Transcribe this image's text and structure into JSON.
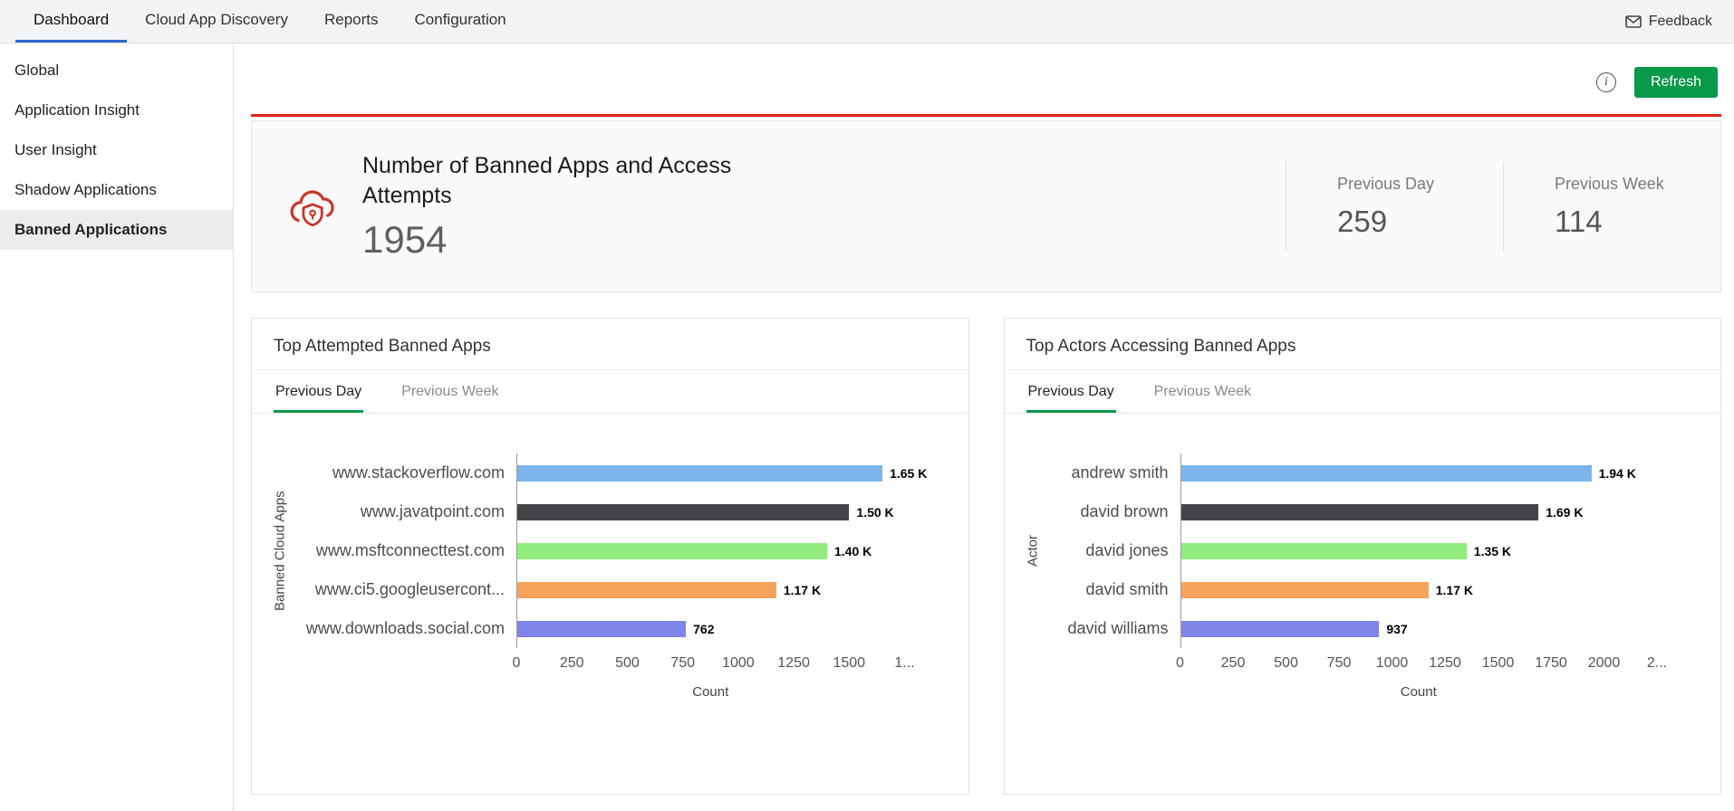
{
  "colors": {
    "accent_blue": "#2e66d0",
    "accent_green": "#089949",
    "accent_red": "#e2231a",
    "icon_red": "#cb3527"
  },
  "topnav": {
    "tabs": [
      {
        "label": "Dashboard",
        "active": true
      },
      {
        "label": "Cloud App Discovery",
        "active": false
      },
      {
        "label": "Reports",
        "active": false
      },
      {
        "label": "Configuration",
        "active": false
      }
    ],
    "feedback_label": "Feedback"
  },
  "sidebar": {
    "items": [
      {
        "label": "Global",
        "active": false
      },
      {
        "label": "Application Insight",
        "active": false
      },
      {
        "label": "User Insight",
        "active": false
      },
      {
        "label": "Shadow Applications",
        "active": false
      },
      {
        "label": "Banned Applications",
        "active": true
      }
    ]
  },
  "toolbar": {
    "refresh_label": "Refresh"
  },
  "summary": {
    "title": "Number of Banned Apps and Access Attempts",
    "total": "1954",
    "stats": [
      {
        "label": "Previous Day",
        "value": "259"
      },
      {
        "label": "Previous Week",
        "value": "114"
      }
    ]
  },
  "cards": [
    {
      "title": "Top Attempted Banned Apps",
      "tabs": [
        {
          "label": "Previous Day",
          "active": true
        },
        {
          "label": "Previous Week",
          "active": false
        }
      ]
    },
    {
      "title": "Top Actors Accessing Banned Apps",
      "tabs": [
        {
          "label": "Previous Day",
          "active": true
        },
        {
          "label": "Previous Week",
          "active": false
        }
      ]
    }
  ],
  "chart_data": [
    {
      "type": "bar",
      "orientation": "horizontal",
      "title": "Top Attempted Banned Apps",
      "categories": [
        "www.stackoverflow.com",
        "www.javatpoint.com",
        "www.msftconnecttest.com",
        "www.ci5.googleusercont...",
        "www.downloads.social.com"
      ],
      "values": [
        1650,
        1500,
        1400,
        1170,
        762
      ],
      "value_labels": [
        "1.65 K",
        "1.50 K",
        "1.40 K",
        "1.17 K",
        "762"
      ],
      "bar_colors": [
        "#7cb5ec",
        "#434348",
        "#90ed7d",
        "#f7a35c",
        "#8085e9"
      ],
      "xlabel": "Count",
      "ylabel": "Banned Cloud Apps",
      "xlim": [
        0,
        1750
      ],
      "x_ticks": [
        {
          "v": 0,
          "label": "0"
        },
        {
          "v": 250,
          "label": "250"
        },
        {
          "v": 500,
          "label": "500"
        },
        {
          "v": 750,
          "label": "750"
        },
        {
          "v": 1000,
          "label": "1000"
        },
        {
          "v": 1250,
          "label": "1250"
        },
        {
          "v": 1500,
          "label": "1500"
        },
        {
          "v": 1750,
          "label": "1..."
        }
      ],
      "label_col_width": 248,
      "grid": false,
      "legend": false
    },
    {
      "type": "bar",
      "orientation": "horizontal",
      "title": "Top Actors Accessing Banned Apps",
      "categories": [
        "andrew smith",
        "david brown",
        "david jones",
        "david smith",
        "david williams"
      ],
      "values": [
        1940,
        1690,
        1350,
        1170,
        937
      ],
      "value_labels": [
        "1.94 K",
        "1.69 K",
        "1.35 K",
        "1.17 K",
        "937"
      ],
      "bar_colors": [
        "#7cb5ec",
        "#434348",
        "#90ed7d",
        "#f7a35c",
        "#8085e9"
      ],
      "xlabel": "Count",
      "ylabel": "Actor",
      "xlim": [
        0,
        2250
      ],
      "x_ticks": [
        {
          "v": 0,
          "label": "0"
        },
        {
          "v": 250,
          "label": "250"
        },
        {
          "v": 500,
          "label": "500"
        },
        {
          "v": 750,
          "label": "750"
        },
        {
          "v": 1000,
          "label": "1000"
        },
        {
          "v": 1250,
          "label": "1250"
        },
        {
          "v": 1500,
          "label": "1500"
        },
        {
          "v": 1750,
          "label": "1750"
        },
        {
          "v": 2000,
          "label": "2000"
        },
        {
          "v": 2250,
          "label": "2..."
        }
      ],
      "label_col_width": 150,
      "grid": false,
      "legend": false
    }
  ]
}
